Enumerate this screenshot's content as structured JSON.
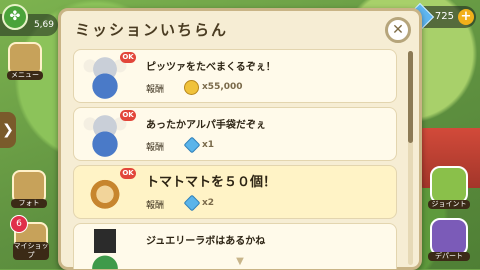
{
  "hud": {
    "coins": "5,69",
    "gems": "725",
    "gem_plus": "+",
    "clover": "✤"
  },
  "left_buttons": {
    "menu_label": "メニュー",
    "photo_label": "フォト",
    "myshop_label": "マイショップ",
    "myshop_badge": "6",
    "arrow": "❯"
  },
  "right_buttons": {
    "joint_label": "ジョイント",
    "depart_label": "デパート"
  },
  "panel": {
    "title": "ミッションいちらん",
    "close": "✕"
  },
  "missions": [
    {
      "title": "ピッツァをたべまくるぞぇ！",
      "reward_label": "報酬",
      "reward_icon": "coin-icon",
      "reward_value": "x55,000",
      "ok": "OK",
      "avatar": "viking",
      "highlight": false,
      "big": false
    },
    {
      "title": "あったかアルパ手袋だぞぇ",
      "reward_label": "報酬",
      "reward_icon": "gem-icon",
      "reward_value": "x1",
      "ok": "OK",
      "avatar": "viking",
      "highlight": false,
      "big": false
    },
    {
      "title": "トマトマトを５０個！",
      "reward_label": "報酬",
      "reward_icon": "gem-icon",
      "reward_value": "x2",
      "ok": "OK",
      "avatar": "lion",
      "highlight": true,
      "big": true
    },
    {
      "title": "ジュエリーラボはあるかね",
      "reward_label": "",
      "reward_icon": "",
      "reward_value": "",
      "ok": "",
      "avatar": "hat",
      "highlight": false,
      "big": false
    }
  ],
  "colors": {
    "panel_bg": "#f6edd4",
    "accent_red": "#e2463a",
    "gem_blue": "#5ab4ea",
    "coin_gold": "#f0c23a"
  }
}
